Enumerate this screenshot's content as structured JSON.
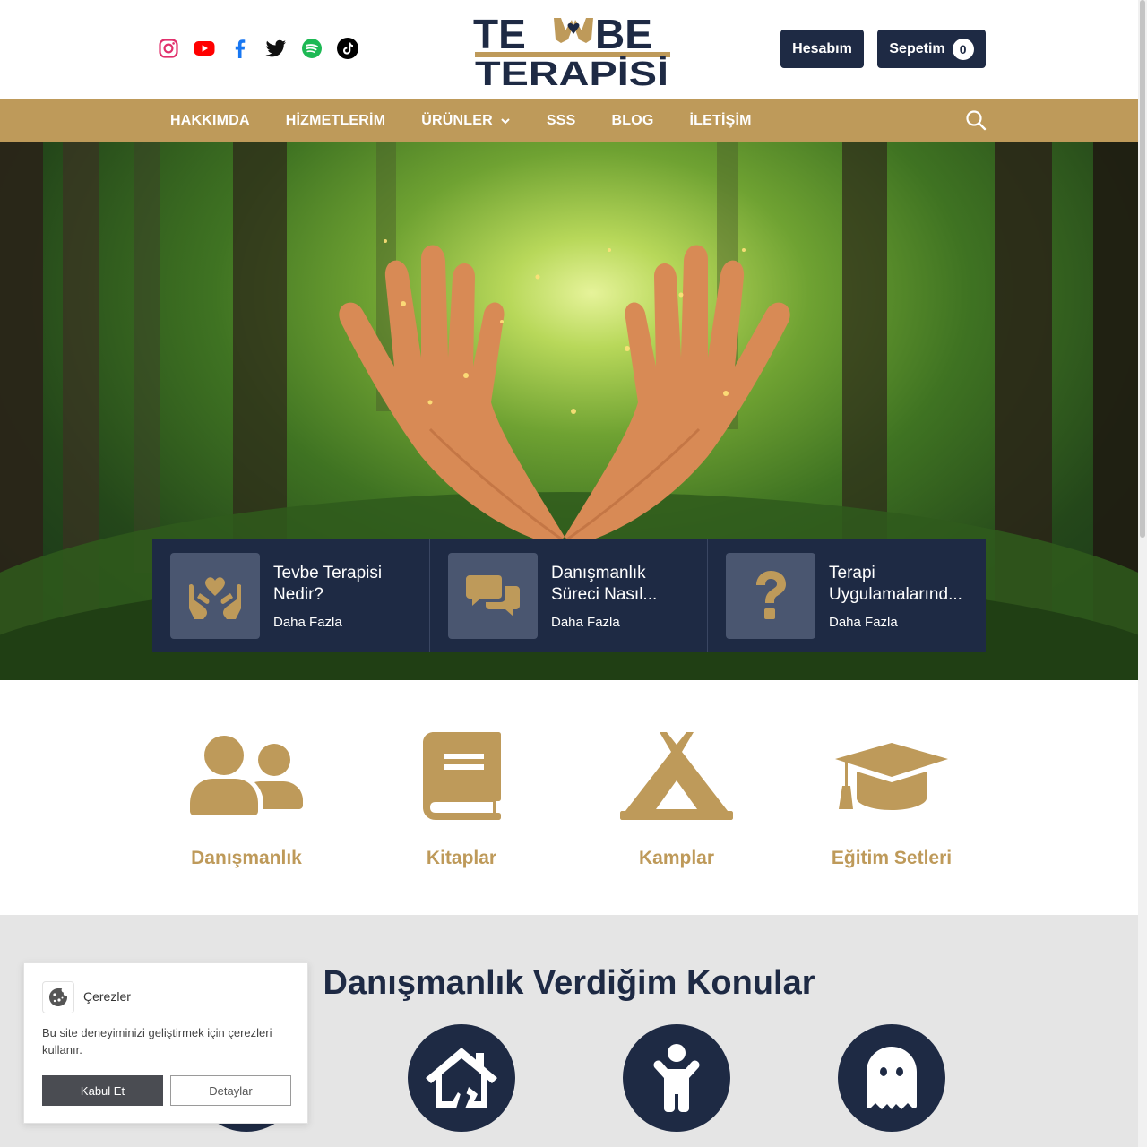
{
  "header": {
    "social": [
      "instagram-icon",
      "youtube-icon",
      "facebook-icon",
      "twitter-icon",
      "spotify-icon",
      "tiktok-icon"
    ],
    "logo_line1_left": "TE",
    "logo_line1_right": "BE",
    "logo_line2": "TERAPİSİ",
    "account_label": "Hesabım",
    "cart_label": "Sepetim",
    "cart_count": "0"
  },
  "nav": {
    "items": [
      {
        "label": "HAKKIMDA"
      },
      {
        "label": "HİZMETLERİM"
      },
      {
        "label": "ÜRÜNLER"
      },
      {
        "label": "SSS"
      },
      {
        "label": "BLOG"
      },
      {
        "label": "İLETİŞİM"
      }
    ]
  },
  "cards": [
    {
      "title_line1": "Tevbe Terapisi",
      "title_line2": "Nedir?",
      "more": "Daha Fazla",
      "icon": "hands-heart-icon"
    },
    {
      "title_line1": "Danışmanlık",
      "title_line2": "Süreci Nasıl...",
      "more": "Daha Fazla",
      "icon": "chat-bubbles-icon"
    },
    {
      "title_line1": "Terapi",
      "title_line2": "Uygulamalarınd...",
      "more": "Daha Fazla",
      "icon": "question-icon"
    }
  ],
  "categories": [
    {
      "label": "Danışmanlık",
      "icon": "users-icon"
    },
    {
      "label": "Kitaplar",
      "icon": "book-icon"
    },
    {
      "label": "Kamplar",
      "icon": "tent-icon"
    },
    {
      "label": "Eğitim Setleri",
      "icon": "graduation-cap-icon"
    }
  ],
  "topics": {
    "title": "Danışmanlık Verdiğim Konular",
    "icons": [
      "broken-house-icon",
      "child-icon",
      "ghost-icon"
    ]
  },
  "cookie": {
    "title": "Çerezler",
    "text": "Bu site deneyiminizi geliştirmek için çerezleri kullanır.",
    "accept": "Kabul Et",
    "details": "Detaylar"
  },
  "colors": {
    "navy": "#1e2a44",
    "gold": "#be9a5a",
    "topics_bg": "#e5e5e5"
  }
}
